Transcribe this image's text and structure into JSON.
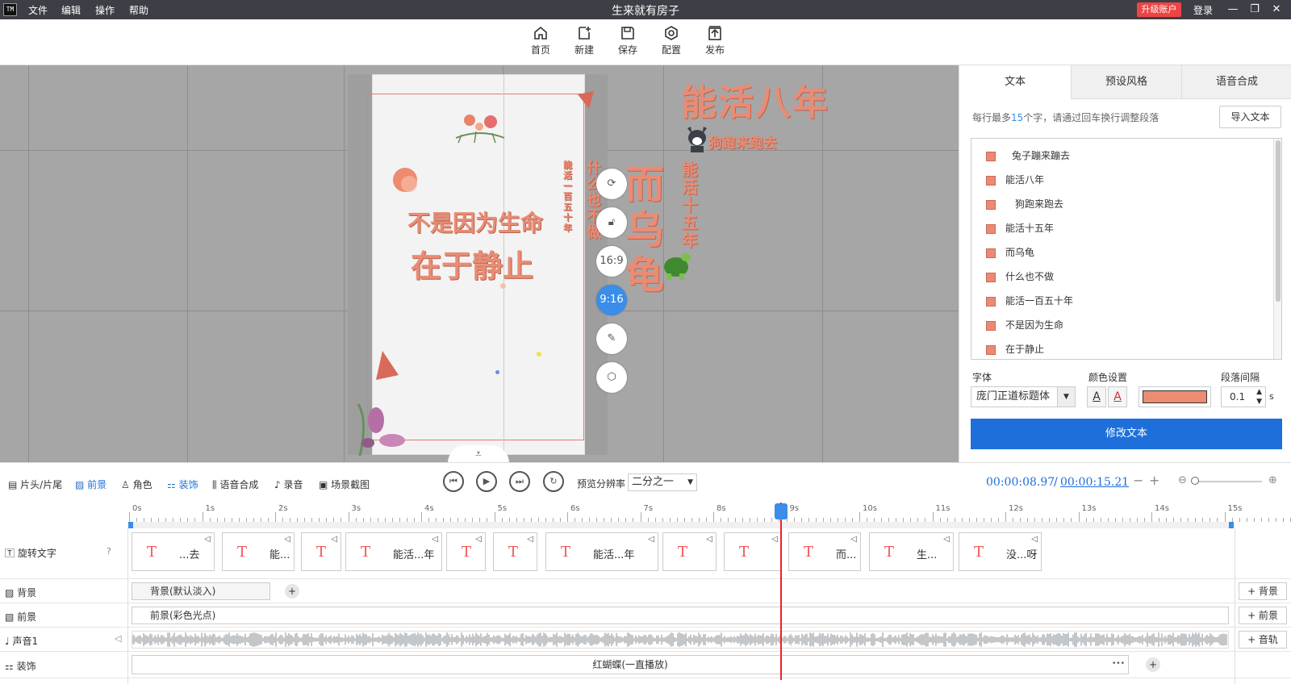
{
  "titlebar": {
    "logo": "TM",
    "menus": [
      "文件",
      "编辑",
      "操作",
      "帮助"
    ],
    "title": "生来就有房子",
    "upgrade": "升级账户",
    "login": "登录"
  },
  "toolbar": {
    "items": [
      {
        "label": "首页",
        "icon": "home-icon"
      },
      {
        "label": "新建",
        "icon": "new-file-icon"
      },
      {
        "label": "保存",
        "icon": "save-icon"
      },
      {
        "label": "配置",
        "icon": "settings-icon"
      },
      {
        "label": "发布",
        "icon": "publish-icon"
      }
    ]
  },
  "canvas": {
    "texts": {
      "t1": "能活八年",
      "t2": "狗跑来跑去",
      "t3": "能活十五年",
      "t4": "而乌龟",
      "t5": "什么也不做",
      "t6": "能活一百五十年",
      "t7": "不是因为生命",
      "t8": "在于静止"
    },
    "side_buttons": {
      "rotate": "rotate-icon",
      "unlock": "unlock-icon",
      "r169": "16:9",
      "r916": "9:16",
      "edit": "edit-icon",
      "settings": "settings-icon"
    }
  },
  "right_panel": {
    "tabs": [
      "文本",
      "预设风格",
      "语音合成"
    ],
    "hint_pre": "每行最多",
    "hint_num": "15",
    "hint_post": "个字，请通过回车换行调整段落",
    "import_button": "导入文本",
    "text_items": [
      "兔子蹦来蹦去",
      "能活八年",
      "狗跑来跑去",
      "能活十五年",
      "而乌龟",
      "什么也不做",
      "能活一百五十年",
      "不是因为生命",
      "在于静止"
    ],
    "font_label": "字体",
    "font_value": "庞门正道标题体",
    "color_label": "颜色设置",
    "accent_color": "#ec8c72",
    "spacing_label": "段落间隔",
    "spacing_value": "0.1",
    "spacing_unit": "s",
    "modify_button": "修改文本"
  },
  "playbar": {
    "tabs": [
      "片头/片尾",
      "前景",
      "角色",
      "装饰",
      "语音合成",
      "录音",
      "场景截图"
    ],
    "res_label": "预览分辨率",
    "res_value": "二分之一",
    "time_current": "00:00:08.97",
    "time_sep": "/",
    "time_total": "00:00:15.21"
  },
  "timeline": {
    "ruler": [
      "0s",
      "1s",
      "2s",
      "3s",
      "4s",
      "5s",
      "6s",
      "7s",
      "8s",
      "9s",
      "10s",
      "11s",
      "12s",
      "13s",
      "14s",
      "15s"
    ],
    "tracks": {
      "rotate_text": {
        "label": "旋转文字",
        "clips": [
          "...去",
          "能...",
          "",
          "能活...年",
          "",
          "",
          "能活...年",
          "",
          "",
          "而...",
          "生...",
          "没...呀"
        ]
      },
      "background": {
        "label": "背景",
        "clip": "背景(默认淡入)",
        "add": "+ 背景"
      },
      "foreground": {
        "label": "前景",
        "clip": "前景(彩色光点)",
        "add": "+ 前景"
      },
      "audio": {
        "label": "声音1",
        "add": "+ 音轨"
      },
      "decor": {
        "label": "装饰",
        "clip": "红蝴蝶(一直播放)",
        "more": "•••"
      }
    }
  }
}
